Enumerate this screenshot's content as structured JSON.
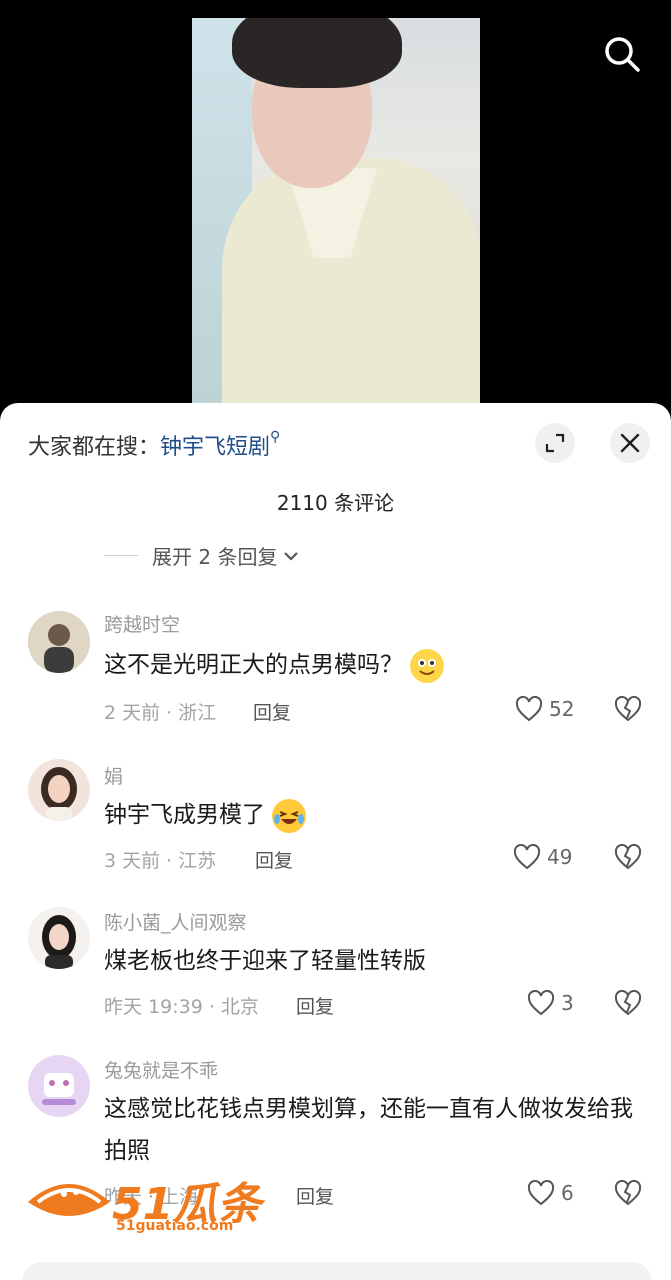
{
  "hot_search": {
    "prefix": "大家都在搜：",
    "keyword": "钟宇飞短剧"
  },
  "comment_count": "2110 条评论",
  "expand_replies": "展开 2 条回复",
  "comments": [
    {
      "user": "跨越时空",
      "text": "这不是光明正大的点男模吗？",
      "time_loc": "2 天前 · 浙江",
      "reply": "回复",
      "likes": "52"
    },
    {
      "user": "娟",
      "text": "钟宇飞成男模了",
      "time_loc": "3 天前 · 江苏",
      "reply": "回复",
      "likes": "49"
    },
    {
      "user": "陈小菌_人间观察",
      "text": "煤老板也终于迎来了轻量性转版",
      "time_loc": "昨天 19:39 · 北京",
      "reply": "回复",
      "likes": "3"
    },
    {
      "user": "兔兔就是不乖",
      "text": "这感觉比花钱点男模划算，还能一直有人做妆发给我拍照",
      "time_loc": "昨天 · 上海",
      "reply": "回复",
      "likes": "6"
    }
  ],
  "watermark": {
    "name": "51瓜条",
    "url": "51guatiao.com"
  },
  "colors": {
    "accent_link": "#1f4e89",
    "watermark": "#f07a1e"
  }
}
